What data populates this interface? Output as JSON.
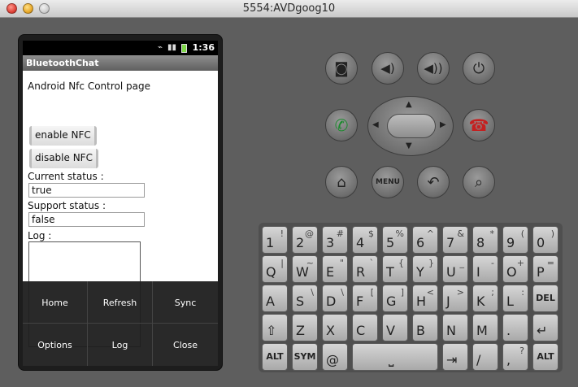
{
  "window": {
    "title": "5554:AVDgoog10"
  },
  "status_bar": {
    "time": "1:36"
  },
  "app": {
    "title": "BluetoothChat",
    "heading": "Android Nfc Control page",
    "enable_label": "enable NFC",
    "disable_label": "disable NFC",
    "current_status_label": "Current status :",
    "current_status_value": "true",
    "support_status_label": "Support status :",
    "support_status_value": "false",
    "log_label": "Log :"
  },
  "menu": {
    "items": [
      {
        "label": "Home"
      },
      {
        "label": "Refresh"
      },
      {
        "label": "Sync"
      },
      {
        "label": "Options"
      },
      {
        "label": "Log"
      },
      {
        "label": "Close"
      }
    ]
  },
  "controls": {
    "menu_label": "MENU"
  },
  "keyboard": {
    "rows": [
      [
        {
          "main": "1",
          "alt": "!"
        },
        {
          "main": "2",
          "alt": "@"
        },
        {
          "main": "3",
          "alt": "#"
        },
        {
          "main": "4",
          "alt": "$"
        },
        {
          "main": "5",
          "alt": "%"
        },
        {
          "main": "6",
          "alt": "^"
        },
        {
          "main": "7",
          "alt": "&"
        },
        {
          "main": "8",
          "alt": "*"
        },
        {
          "main": "9",
          "alt": "("
        },
        {
          "main": "0",
          "alt": ")"
        }
      ],
      [
        {
          "main": "Q",
          "alt": "|"
        },
        {
          "main": "W",
          "alt": "~"
        },
        {
          "main": "E",
          "alt": "\""
        },
        {
          "main": "R",
          "alt": "`"
        },
        {
          "main": "T",
          "alt": "{"
        },
        {
          "main": "Y",
          "alt": "}"
        },
        {
          "main": "U",
          "alt": "_"
        },
        {
          "main": "I",
          "alt": "-"
        },
        {
          "main": "O",
          "alt": "+"
        },
        {
          "main": "P",
          "alt": "="
        }
      ],
      [
        {
          "main": "A",
          "alt": ""
        },
        {
          "main": "S",
          "alt": "\\"
        },
        {
          "main": "D",
          "alt": "\\"
        },
        {
          "main": "F",
          "alt": "["
        },
        {
          "main": "G",
          "alt": "]"
        },
        {
          "main": "H",
          "alt": "<"
        },
        {
          "main": "J",
          "alt": ">"
        },
        {
          "main": "K",
          "alt": ";"
        },
        {
          "main": "L",
          "alt": ":"
        },
        {
          "main": "DEL",
          "alt": ""
        }
      ],
      [
        {
          "main": "⇧",
          "alt": ""
        },
        {
          "main": "Z",
          "alt": ""
        },
        {
          "main": "X",
          "alt": ""
        },
        {
          "main": "C",
          "alt": ""
        },
        {
          "main": "V",
          "alt": ""
        },
        {
          "main": "B",
          "alt": ""
        },
        {
          "main": "N",
          "alt": ""
        },
        {
          "main": "M",
          "alt": ""
        },
        {
          "main": ".",
          "alt": ""
        },
        {
          "main": "↵",
          "alt": ""
        }
      ],
      [
        {
          "main": "ALT",
          "alt": ""
        },
        {
          "main": "SYM",
          "alt": ""
        },
        {
          "main": "@",
          "alt": ""
        },
        {
          "main": "",
          "alt": ""
        },
        {
          "main": "⎵",
          "alt": ""
        },
        {
          "main": "",
          "alt": ""
        },
        {
          "main": "⇥",
          "alt": ""
        },
        {
          "main": "/",
          "alt": ""
        },
        {
          "main": ",",
          "alt": "?"
        },
        {
          "main": "ALT",
          "alt": ""
        }
      ]
    ]
  }
}
